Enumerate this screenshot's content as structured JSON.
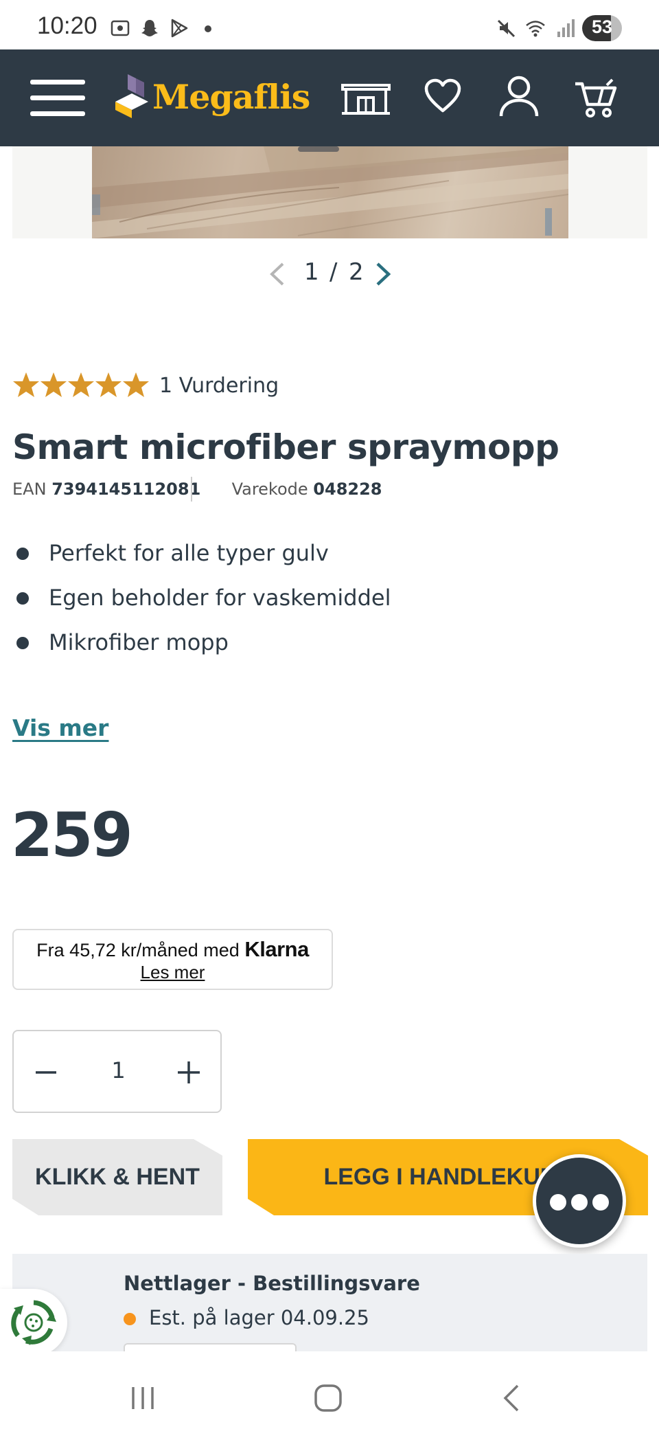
{
  "status_bar": {
    "time": "10:20",
    "battery": "53",
    "icons": [
      "screenshot-icon",
      "snapchat-icon",
      "play-store-icon",
      "dot-icon",
      "mute-icon",
      "wifi-icon",
      "signal-icon",
      "battery-icon"
    ]
  },
  "header": {
    "brand": "Megaflis",
    "icons": [
      "menu-icon",
      "megaflis-logo-icon",
      "store-icon",
      "favorites-icon",
      "account-icon",
      "cart-icon"
    ]
  },
  "gallery": {
    "current": "1",
    "separator": "/",
    "total": "2"
  },
  "rating": {
    "stars": 5,
    "text": "1 Vurdering"
  },
  "product": {
    "title": "Smart microfiber spraymopp",
    "ean_label": "EAN",
    "ean_value": "7394145112081",
    "varekode_label": "Varekode",
    "varekode_value": "048228",
    "features": [
      "Perfekt for alle typer gulv",
      "Egen beholder for vaskemiddel",
      "Mikrofiber mopp"
    ],
    "vis_mer": "Vis mer",
    "price": "259"
  },
  "klarna": {
    "text": "Fra 45,72 kr/måned med",
    "logo": "Klarna",
    "link": "Les mer"
  },
  "quantity": {
    "value": "1"
  },
  "actions": {
    "klikk_hent": "KLIKK & HENT",
    "legg_i": "LEGG I HANDLEKURV"
  },
  "stock": {
    "title": "Nettlager - Bestillingsvare",
    "status": "Est. på lager 04.09.25",
    "status_color": "#f7941d"
  },
  "colors": {
    "header_bg": "#2e3a45",
    "brand_yellow": "#fbbc1a",
    "star": "#d9962a",
    "link": "#2a7a86",
    "text": "#2d3a45"
  },
  "nav_bar": {
    "icons": [
      "recent-apps-icon",
      "home-icon",
      "back-icon"
    ]
  }
}
